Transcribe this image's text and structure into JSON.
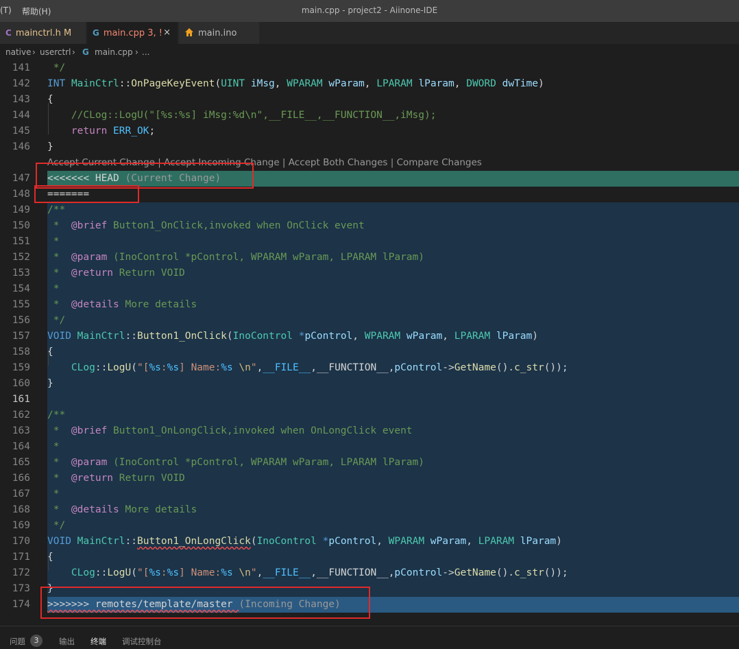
{
  "menu": {
    "prefix": "(T)",
    "help": "帮助(H)"
  },
  "window_title": "main.cpp - project2 - Aiinone-IDE",
  "tabs": [
    {
      "label": "mainctrl.h M",
      "icon": "C",
      "color": "#e0b0ff"
    },
    {
      "label": "main.cpp 3, !",
      "icon": "G",
      "color": "#f48771",
      "active": true
    },
    {
      "label": "main.ino",
      "icon": "home",
      "color": "#ccc"
    }
  ],
  "tab_close": "×",
  "breadcrumb": {
    "part1": "native",
    "part2": "userctrl",
    "file_icon": "G",
    "part3": "main.cpp",
    "part4": "..."
  },
  "codelens": "Accept Current Change | Accept Incoming Change | Accept Both Changes | Compare Changes",
  "lines": [
    {
      "n": "141",
      "tokens": [
        [
          "c-cm",
          " */"
        ]
      ]
    },
    {
      "n": "142",
      "tokens": [
        [
          "c-kw",
          "INT"
        ],
        [
          "c-op",
          " "
        ],
        [
          "c-ty",
          "MainCtrl"
        ],
        [
          "c-op",
          "::"
        ],
        [
          "c-fn",
          "OnPageKeyEvent"
        ],
        [
          "c-op",
          "("
        ],
        [
          "c-ty",
          "UINT"
        ],
        [
          "c-op",
          " "
        ],
        [
          "c-var",
          "iMsg"
        ],
        [
          "c-op",
          ", "
        ],
        [
          "c-ty",
          "WPARAM"
        ],
        [
          "c-op",
          " "
        ],
        [
          "c-var",
          "wParam"
        ],
        [
          "c-op",
          ", "
        ],
        [
          "c-ty",
          "LPARAM"
        ],
        [
          "c-op",
          " "
        ],
        [
          "c-var",
          "lParam"
        ],
        [
          "c-op",
          ", "
        ],
        [
          "c-ty",
          "DWORD"
        ],
        [
          "c-op",
          " "
        ],
        [
          "c-var",
          "dwTime"
        ],
        [
          "c-op",
          ")"
        ]
      ]
    },
    {
      "n": "143",
      "tokens": [
        [
          "c-op",
          "{"
        ]
      ]
    },
    {
      "n": "144",
      "tokens": [
        [
          "c-cm",
          "    //CLog::LogU(\"[%s:%s] iMsg:%d\\n\",__FILE__,__FUNCTION__,iMsg);"
        ]
      ]
    },
    {
      "n": "145",
      "tokens": [
        [
          "c-op",
          "    "
        ],
        [
          "c-ctl",
          "return"
        ],
        [
          "c-op",
          " "
        ],
        [
          "c-const",
          "ERR_OK"
        ],
        [
          "c-op",
          ";"
        ]
      ]
    },
    {
      "n": "146",
      "tokens": [
        [
          "c-op",
          "}"
        ]
      ]
    },
    {
      "n": "",
      "codelens": true
    },
    {
      "n": "147",
      "tokens": [
        [
          "c-op",
          "<<<<<<< HEAD "
        ],
        [
          "c-gray",
          "(Current Change)"
        ]
      ],
      "bg": "current"
    },
    {
      "n": "148",
      "tokens": [
        [
          "c-op",
          "======="
        ]
      ]
    },
    {
      "n": "149",
      "tokens": [
        [
          "c-cm",
          "/**"
        ]
      ],
      "bg": "incoming"
    },
    {
      "n": "150",
      "tokens": [
        [
          "c-cm",
          " *  "
        ],
        [
          "c-tag",
          "@brief"
        ],
        [
          "c-cm",
          " Button1_OnClick,invoked when OnClick event"
        ]
      ],
      "bg": "incoming"
    },
    {
      "n": "151",
      "tokens": [
        [
          "c-cm",
          " *"
        ]
      ],
      "bg": "incoming"
    },
    {
      "n": "152",
      "tokens": [
        [
          "c-cm",
          " *  "
        ],
        [
          "c-tag",
          "@param"
        ],
        [
          "c-cm",
          " (InoControl *pControl, WPARAM wParam, LPARAM lParam)"
        ]
      ],
      "bg": "incoming"
    },
    {
      "n": "153",
      "tokens": [
        [
          "c-cm",
          " *  "
        ],
        [
          "c-tag",
          "@return"
        ],
        [
          "c-cm",
          " Return VOID"
        ]
      ],
      "bg": "incoming"
    },
    {
      "n": "154",
      "tokens": [
        [
          "c-cm",
          " *"
        ]
      ],
      "bg": "incoming"
    },
    {
      "n": "155",
      "tokens": [
        [
          "c-cm",
          " *  "
        ],
        [
          "c-tag",
          "@details"
        ],
        [
          "c-cm",
          " More details"
        ]
      ],
      "bg": "incoming"
    },
    {
      "n": "156",
      "tokens": [
        [
          "c-cm",
          " */"
        ]
      ],
      "bg": "incoming"
    },
    {
      "n": "157",
      "tokens": [
        [
          "c-kw",
          "VOID"
        ],
        [
          "c-op",
          " "
        ],
        [
          "c-ty",
          "MainCtrl"
        ],
        [
          "c-op",
          "::"
        ],
        [
          "c-fn",
          "Button1_OnClick"
        ],
        [
          "c-op",
          "("
        ],
        [
          "c-ty",
          "InoControl"
        ],
        [
          "c-op",
          " "
        ],
        [
          "c-kw",
          "*"
        ],
        [
          "c-var",
          "pControl"
        ],
        [
          "c-op",
          ", "
        ],
        [
          "c-ty",
          "WPARAM"
        ],
        [
          "c-op",
          " "
        ],
        [
          "c-var",
          "wParam"
        ],
        [
          "c-op",
          ", "
        ],
        [
          "c-ty",
          "LPARAM"
        ],
        [
          "c-op",
          " "
        ],
        [
          "c-var",
          "lParam"
        ],
        [
          "c-op",
          ")"
        ]
      ],
      "bg": "incoming"
    },
    {
      "n": "158",
      "tokens": [
        [
          "c-op",
          "{"
        ]
      ],
      "bg": "incoming"
    },
    {
      "n": "159",
      "tokens": [
        [
          "c-op",
          "    "
        ],
        [
          "c-ty",
          "CLog"
        ],
        [
          "c-op",
          "::"
        ],
        [
          "c-fn",
          "LogU"
        ],
        [
          "c-op",
          "("
        ],
        [
          "c-str",
          "\"["
        ],
        [
          "c-const",
          "%s"
        ],
        [
          "c-str",
          ":"
        ],
        [
          "c-const",
          "%s"
        ],
        [
          "c-str",
          "] Name:"
        ],
        [
          "c-const",
          "%s"
        ],
        [
          "c-str",
          " "
        ],
        [
          "c-esc",
          "\\n"
        ],
        [
          "c-str",
          "\""
        ],
        [
          "c-op",
          ","
        ],
        [
          "c-const",
          "__FILE__"
        ],
        [
          "c-op",
          ",__FUNCTION__,"
        ],
        [
          "c-var",
          "pControl"
        ],
        [
          "c-op",
          "->"
        ],
        [
          "c-fn",
          "GetName"
        ],
        [
          "c-op",
          "()."
        ],
        [
          "c-fn",
          "c_str"
        ],
        [
          "c-op",
          "());"
        ]
      ],
      "bg": "incoming"
    },
    {
      "n": "160",
      "tokens": [
        [
          "c-op",
          "}"
        ]
      ],
      "bg": "incoming"
    },
    {
      "n": "161",
      "tokens": [],
      "bg": "incoming",
      "cur": true
    },
    {
      "n": "162",
      "tokens": [
        [
          "c-cm",
          "/**"
        ]
      ],
      "bg": "incoming"
    },
    {
      "n": "163",
      "tokens": [
        [
          "c-cm",
          " *  "
        ],
        [
          "c-tag",
          "@brief"
        ],
        [
          "c-cm",
          " Button1_OnLongClick,invoked when OnLongClick event"
        ]
      ],
      "bg": "incoming"
    },
    {
      "n": "164",
      "tokens": [
        [
          "c-cm",
          " *"
        ]
      ],
      "bg": "incoming"
    },
    {
      "n": "165",
      "tokens": [
        [
          "c-cm",
          " *  "
        ],
        [
          "c-tag",
          "@param"
        ],
        [
          "c-cm",
          " (InoControl *pControl, WPARAM wParam, LPARAM lParam)"
        ]
      ],
      "bg": "incoming"
    },
    {
      "n": "166",
      "tokens": [
        [
          "c-cm",
          " *  "
        ],
        [
          "c-tag",
          "@return"
        ],
        [
          "c-cm",
          " Return VOID"
        ]
      ],
      "bg": "incoming"
    },
    {
      "n": "167",
      "tokens": [
        [
          "c-cm",
          " *"
        ]
      ],
      "bg": "incoming"
    },
    {
      "n": "168",
      "tokens": [
        [
          "c-cm",
          " *  "
        ],
        [
          "c-tag",
          "@details"
        ],
        [
          "c-cm",
          " More details"
        ]
      ],
      "bg": "incoming"
    },
    {
      "n": "169",
      "tokens": [
        [
          "c-cm",
          " */"
        ]
      ],
      "bg": "incoming"
    },
    {
      "n": "170",
      "tokens": [
        [
          "c-kw",
          "VOID"
        ],
        [
          "c-op",
          " "
        ],
        [
          "c-ty",
          "MainCtrl"
        ],
        [
          "c-op",
          "::"
        ],
        [
          "c-fn squig",
          "Button1_OnLongClick"
        ],
        [
          "c-op",
          "("
        ],
        [
          "c-ty",
          "InoControl"
        ],
        [
          "c-op",
          " "
        ],
        [
          "c-kw",
          "*"
        ],
        [
          "c-var",
          "pControl"
        ],
        [
          "c-op",
          ", "
        ],
        [
          "c-ty",
          "WPARAM"
        ],
        [
          "c-op",
          " "
        ],
        [
          "c-var",
          "wParam"
        ],
        [
          "c-op",
          ", "
        ],
        [
          "c-ty",
          "LPARAM"
        ],
        [
          "c-op",
          " "
        ],
        [
          "c-var",
          "lParam"
        ],
        [
          "c-op",
          ")"
        ]
      ],
      "bg": "incoming"
    },
    {
      "n": "171",
      "tokens": [
        [
          "c-op",
          "{"
        ]
      ],
      "bg": "incoming"
    },
    {
      "n": "172",
      "tokens": [
        [
          "c-op",
          "    "
        ],
        [
          "c-ty",
          "CLog"
        ],
        [
          "c-op",
          "::"
        ],
        [
          "c-fn",
          "LogU"
        ],
        [
          "c-op",
          "("
        ],
        [
          "c-str",
          "\"["
        ],
        [
          "c-const",
          "%s"
        ],
        [
          "c-str",
          ":"
        ],
        [
          "c-const",
          "%s"
        ],
        [
          "c-str",
          "] Name:"
        ],
        [
          "c-const",
          "%s"
        ],
        [
          "c-str",
          " "
        ],
        [
          "c-esc",
          "\\n"
        ],
        [
          "c-str",
          "\""
        ],
        [
          "c-op",
          ","
        ],
        [
          "c-const",
          "__FILE__"
        ],
        [
          "c-op",
          ",__FUNCTION__,"
        ],
        [
          "c-var",
          "pControl"
        ],
        [
          "c-op",
          "->"
        ],
        [
          "c-fn",
          "GetName"
        ],
        [
          "c-op",
          "()."
        ],
        [
          "c-fn",
          "c_str"
        ],
        [
          "c-op",
          "());"
        ]
      ],
      "bg": "incoming"
    },
    {
      "n": "173",
      "tokens": [
        [
          "c-op",
          "}"
        ]
      ],
      "bg": "incoming"
    },
    {
      "n": "174",
      "tokens": [
        [
          "c-op squig",
          ">>>>>>> remotes/template/master "
        ],
        [
          "c-gray",
          "(Incoming Change)"
        ]
      ],
      "bg": "incoming-marker"
    }
  ],
  "panel": {
    "problems": "问题",
    "problems_count": "3",
    "output": "输出",
    "terminal": "终端",
    "debug_console": "调试控制台"
  }
}
